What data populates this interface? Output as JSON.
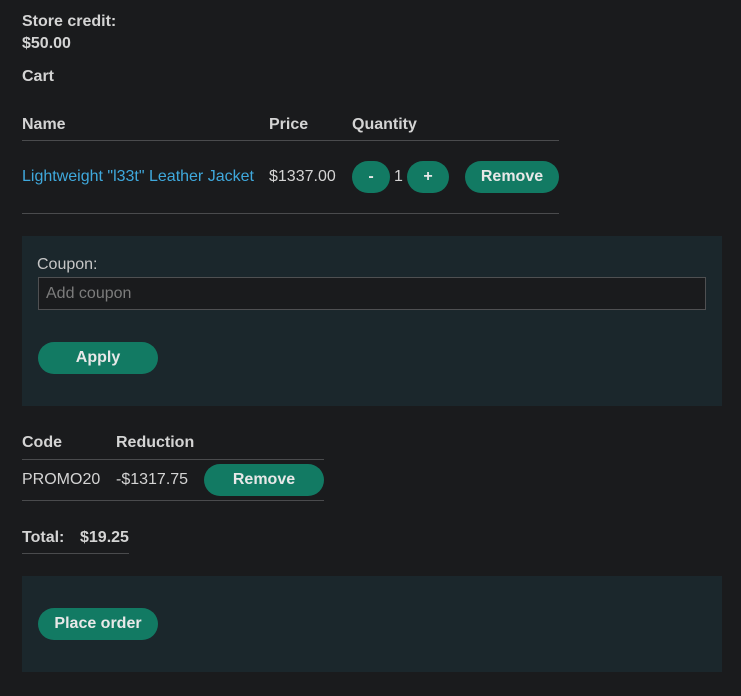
{
  "account": {
    "store_credit_label": "Store credit:",
    "store_credit_value": "$50.00"
  },
  "cart": {
    "heading": "Cart",
    "columns": [
      "Name",
      "Price",
      "Quantity"
    ],
    "items": [
      {
        "name": "Lightweight \"l33t\" Leather Jacket",
        "price": "$1337.00",
        "quantity": "1",
        "minus_label": "-",
        "plus_label": "+",
        "remove_label": "Remove"
      }
    ]
  },
  "coupon": {
    "label": "Coupon:",
    "placeholder": "Add coupon",
    "value": "",
    "apply_label": "Apply"
  },
  "discounts": {
    "columns": [
      "Code",
      "Reduction"
    ],
    "rows": [
      {
        "code": "PROMO20",
        "reduction": "-$1317.75",
        "remove_label": "Remove"
      }
    ]
  },
  "total": {
    "label": "Total:",
    "value": "$19.25"
  },
  "order": {
    "place_label": "Place order"
  },
  "colors": {
    "background": "#1a1b1d",
    "panel": "#1b272c",
    "button": "#127a63",
    "link": "#3fa9dd"
  }
}
